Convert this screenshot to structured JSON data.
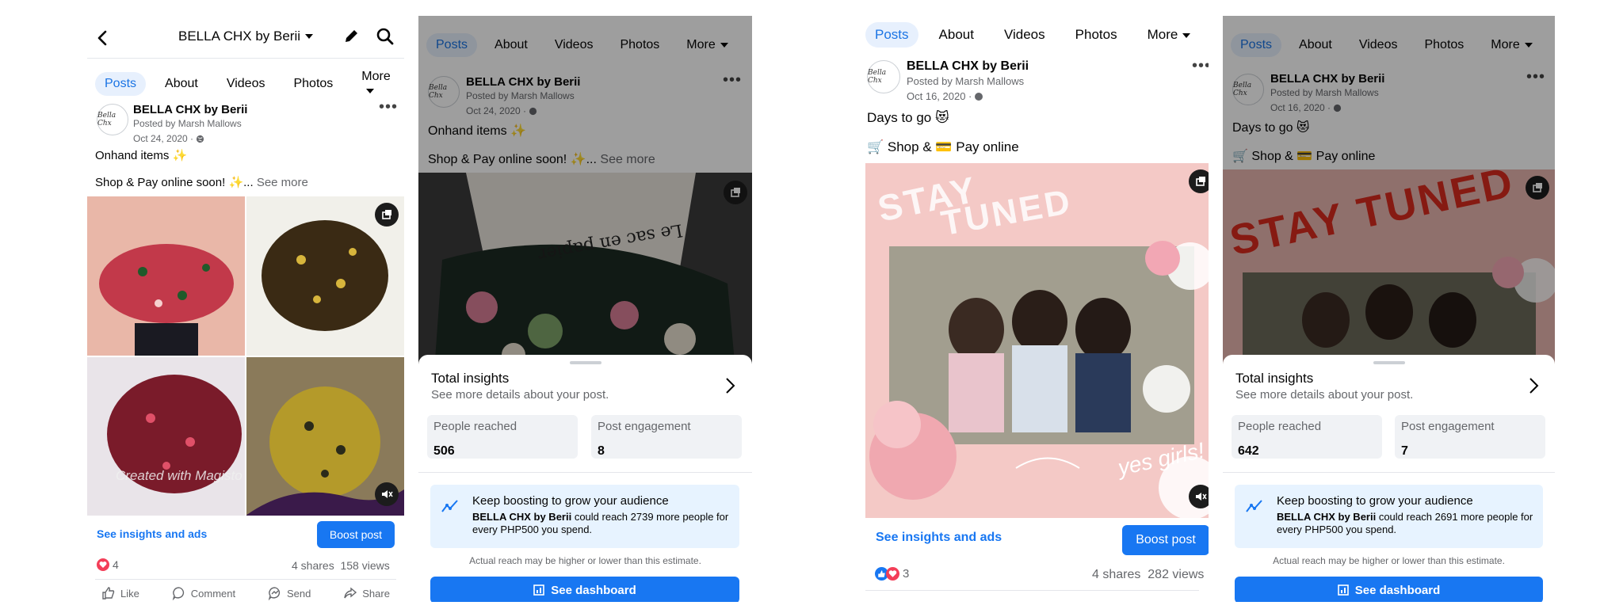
{
  "panel1": {
    "page_title": "BELLA CHX by Berii",
    "tabs": [
      "Posts",
      "About",
      "Videos",
      "Photos",
      "More"
    ],
    "page_name": "BELLA CHX by Berii",
    "posted_by": "Posted by Marsh Mallows",
    "date": "Oct 24, 2020 ·",
    "avatar_text": "Bella Chx",
    "text_line1": "Onhand items ✨",
    "text_line2": "Shop & Pay online soon! ✨...",
    "see_more": "See more",
    "watermark": "Created with Magisto",
    "see_insights": "See insights and ads",
    "boost": "Boost post",
    "reactions": "4",
    "shares": "4 shares",
    "views": "158 views",
    "actions": [
      "Like",
      "Comment",
      "Send",
      "Share"
    ]
  },
  "panel2": {
    "tabs": [
      "Posts",
      "About",
      "Videos",
      "Photos",
      "More"
    ],
    "page_name": "BELLA CHX by Berii",
    "posted_by": "Posted by Marsh Mallows",
    "date": "Oct 24, 2020 ·",
    "avatar_text": "Bella Chx",
    "text_line1": "Onhand items ✨",
    "text_line2": "Shop & Pay online soon! ✨...",
    "see_more": "See more",
    "photo_text": "Le sac en papier",
    "insights_title": "Total insights",
    "insights_sub": "See more details about your post.",
    "reached_label": "People reached",
    "reached_value": "506",
    "engagement_label": "Post engagement",
    "engagement_value": "8",
    "boost_title": "Keep boosting to grow your audience",
    "boost_page": "BELLA CHX by Berii",
    "boost_rest": " could reach 2739 more people for every PHP500 you spend.",
    "estimate_note": "Actual reach may be higher or lower than this estimate.",
    "dashboard": "See dashboard"
  },
  "panel3": {
    "tabs": [
      "Posts",
      "About",
      "Videos",
      "Photos",
      "More"
    ],
    "page_name": "BELLA CHX by Berii",
    "posted_by": "Posted by Marsh Mallows",
    "date": "Oct 16, 2020 ·",
    "avatar_text": "Bella Chx",
    "text_line1": "Days to go 😻",
    "text_line2": "🛒 Shop & 💳 Pay online",
    "stay": "STAY",
    "tuned": "TUNED",
    "yes_girls": "yes girls!",
    "see_insights": "See insights and ads",
    "boost": "Boost post",
    "reactions": "3",
    "shares": "4 shares",
    "views": "282 views"
  },
  "panel4": {
    "tabs": [
      "Posts",
      "About",
      "Videos",
      "Photos",
      "More"
    ],
    "page_name": "BELLA CHX by Berii",
    "posted_by": "Posted by Marsh Mallows",
    "date": "Oct 16, 2020 ·",
    "avatar_text": "Bella Chx",
    "text_line1": "Days to go 😻",
    "text_line2": "🛒 Shop & 💳 Pay online",
    "stay_tuned": "STAY TUNED",
    "insights_title": "Total insights",
    "insights_sub": "See more details about your post.",
    "reached_label": "People reached",
    "reached_value": "642",
    "engagement_label": "Post engagement",
    "engagement_value": "7",
    "boost_title": "Keep boosting to grow your audience",
    "boost_page": "BELLA CHX by Berii",
    "boost_rest": " could reach 2691 more people for every PHP500 you spend.",
    "estimate_note": "Actual reach may be higher or lower than this estimate.",
    "dashboard": "See dashboard"
  },
  "colors": {
    "accent": "#1877f2",
    "tab_active_bg": "#e7f0fd",
    "sheet_bg": "#ffffff",
    "boost_bg": "#e7f3ff",
    "love_red": "#f33e58"
  },
  "icons": [
    "back-icon",
    "caret-down-icon",
    "pencil-icon",
    "search-icon",
    "more-dots-icon",
    "globe-icon",
    "multi-photo-icon",
    "mute-icon",
    "chevron-right-icon",
    "chart-trend-icon",
    "dashboard-icon",
    "like-icon",
    "comment-icon",
    "send-icon",
    "share-icon",
    "love-reaction-icon",
    "like-reaction-icon"
  ]
}
